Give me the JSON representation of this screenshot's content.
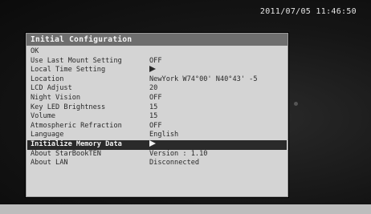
{
  "status": {
    "datetime": "2011/07/05 11:46:50"
  },
  "dialog": {
    "title": "Initial Configuration",
    "ok_label": "OK",
    "rows": [
      {
        "label": "Use Last Mount Setting",
        "value": "OFF"
      },
      {
        "label": "Local Time Setting",
        "value": "",
        "icon": "right-arrow-icon"
      },
      {
        "label": "Location",
        "value": "NewYork W74°00' N40°43' -5"
      },
      {
        "label": "LCD Adjust",
        "value": "20"
      },
      {
        "label": "Night Vision",
        "value": "OFF"
      },
      {
        "label": "Key LED Brightness",
        "value": "15"
      },
      {
        "label": "Volume",
        "value": "15"
      },
      {
        "label": "Atmospheric Refraction",
        "value": "OFF"
      },
      {
        "label": "Language",
        "value": "English"
      },
      {
        "label": "Initialize Memory Data",
        "value": "",
        "icon": "right-arrow-icon",
        "selected": true
      },
      {
        "label": "About StarBookTEN",
        "value": "Version : 1.10"
      },
      {
        "label": "About LAN",
        "value": "Disconnected"
      }
    ]
  }
}
